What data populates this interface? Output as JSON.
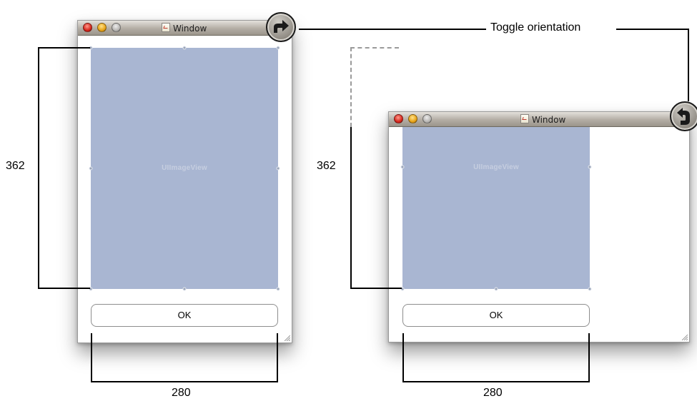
{
  "callout": {
    "label": "Toggle orientation"
  },
  "portrait": {
    "window_title": "Window",
    "image_view_label": "UIImageView",
    "ok_label": "OK",
    "height_label": "362",
    "width_label": "280"
  },
  "landscape": {
    "window_title": "Window",
    "image_view_label": "UIImageView",
    "ok_label": "OK",
    "height_label": "362",
    "width_label": "280"
  },
  "icons": {
    "toggle": "rotate-arrow-icon",
    "close": "close-light-icon",
    "minimize": "minimize-light-icon",
    "zoom": "zoom-light-icon",
    "document": "document-icon",
    "grip": "resize-grip-icon"
  },
  "colors": {
    "image_view": "#a9b6d2",
    "image_view_label": "#c6cee0",
    "title_bar": "#b3ada4",
    "dashed_guide": "#9a9a9a"
  }
}
